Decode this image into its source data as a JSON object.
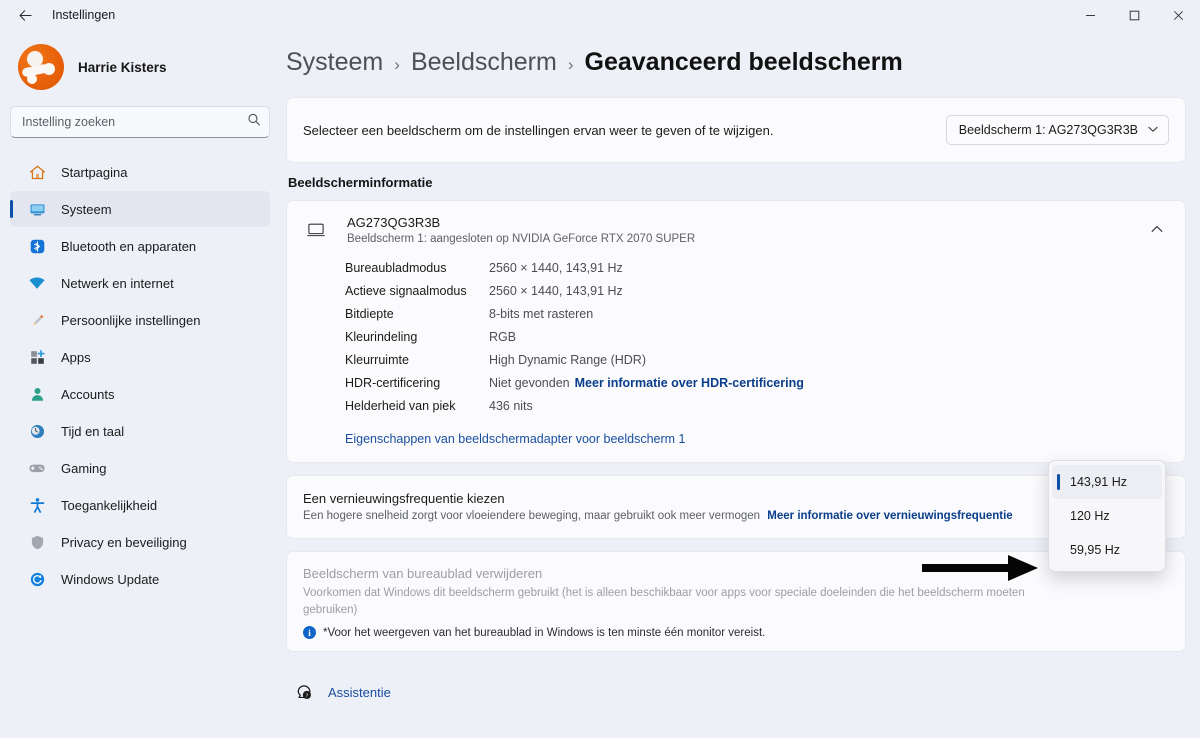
{
  "titlebar": {
    "back_icon": "back-arrow-icon",
    "title": "Instellingen",
    "minimize": "─",
    "maximize": "☐",
    "close": "✕"
  },
  "sidebar": {
    "profile_name": "Harrie Kisters",
    "search_placeholder": "Instelling zoeken",
    "search_value": "",
    "items": [
      {
        "label": "Startpagina",
        "icon": "home-icon",
        "active": false
      },
      {
        "label": "Systeem",
        "icon": "monitor-icon",
        "active": true
      },
      {
        "label": "Bluetooth en apparaten",
        "icon": "bluetooth-icon",
        "active": false
      },
      {
        "label": "Netwerk en internet",
        "icon": "wifi-icon",
        "active": false
      },
      {
        "label": "Persoonlijke instellingen",
        "icon": "paintbrush-icon",
        "active": false
      },
      {
        "label": "Apps",
        "icon": "apps-icon",
        "active": false
      },
      {
        "label": "Accounts",
        "icon": "person-icon",
        "active": false
      },
      {
        "label": "Tijd en taal",
        "icon": "clock-globe-icon",
        "active": false
      },
      {
        "label": "Gaming",
        "icon": "gamepad-icon",
        "active": false
      },
      {
        "label": "Toegankelijkheid",
        "icon": "accessibility-icon",
        "active": false
      },
      {
        "label": "Privacy en beveiliging",
        "icon": "shield-icon",
        "active": false
      },
      {
        "label": "Windows Update",
        "icon": "update-icon",
        "active": false
      }
    ]
  },
  "breadcrumb": {
    "parent": "Systeem",
    "sep1": "›",
    "middle": "Beeldscherm",
    "sep2": "›",
    "current": "Geavanceerd beeldscherm"
  },
  "select_display": {
    "text": "Selecteer een beeldscherm om de instellingen ervan weer te geven of te wijzigen.",
    "combo_value": "Beeldscherm 1: AG273QG3R3B",
    "combo_chevron": "⌄"
  },
  "display_info": {
    "section_title": "Beeldscherminformatie",
    "monitor_name": "AG273QG3R3B",
    "monitor_sub": "Beeldscherm 1: aangesloten op NVIDIA GeForce RTX 2070 SUPER",
    "expander_icon": "chevron-up-icon",
    "rows": [
      {
        "key": "Bureaubladmodus",
        "value": "2560 × 1440, 143,91 Hz",
        "link": ""
      },
      {
        "key": "Actieve signaalmodus",
        "value": "2560 × 1440, 143,91 Hz",
        "link": ""
      },
      {
        "key": "Bitdiepte",
        "value": "8-bits met rasteren",
        "link": ""
      },
      {
        "key": "Kleurindeling",
        "value": "RGB",
        "link": ""
      },
      {
        "key": "Kleurruimte",
        "value": "High Dynamic Range (HDR)",
        "link": ""
      },
      {
        "key": "HDR-certificering",
        "value": "Niet gevonden",
        "link": "Meer informatie over HDR-certificering"
      },
      {
        "key": "Helderheid van piek",
        "value": "436 nits",
        "link": ""
      }
    ],
    "adapter_link": "Eigenschappen van beeldschermadapter voor beeldscherm 1"
  },
  "refresh_rate": {
    "title": "Een vernieuwingsfrequentie kiezen",
    "subtitle": "Een hogere snelheid zorgt voor vloeiendere beweging, maar gebruikt ook meer vermogen",
    "link": "Meer informatie over vernieuwingsfrequentie",
    "options": [
      {
        "label": "143,91 Hz",
        "selected": true
      },
      {
        "label": "120 Hz",
        "selected": false
      },
      {
        "label": "59,95 Hz",
        "selected": false
      }
    ]
  },
  "remove_display": {
    "title": "Beeldscherm van bureaublad verwijderen",
    "subtitle": "Voorkomen dat Windows dit beeldscherm gebruikt (het is alleen beschikbaar voor apps voor speciale doeleinden die het beeldscherm moeten gebruiken)",
    "info_glyph": "i",
    "note": "*Voor het weergeven van het bureaublad in Windows is ten minste één monitor vereist."
  },
  "assistance": {
    "icon": "help-bubble-icon",
    "label": "Assistentie"
  },
  "colors": {
    "page_bg": "#eef0f7",
    "card_bg": "#fbfbfd",
    "accent": "#0b4fa8",
    "link": "#1a4fa0",
    "link_bold": "#0a3e8c",
    "avatar": "#e8610b",
    "info_blue": "#1265c8"
  }
}
